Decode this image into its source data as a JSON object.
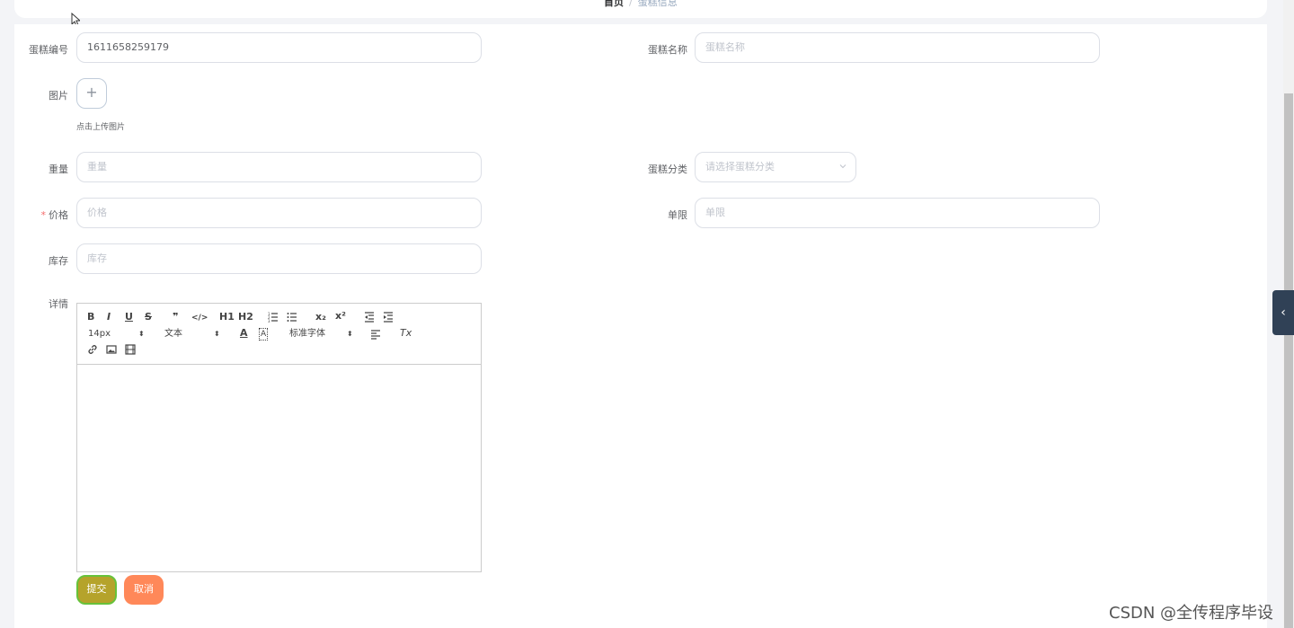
{
  "breadcrumb": {
    "home": "首页",
    "separator": "/",
    "current": "蛋糕信息"
  },
  "form": {
    "cake_no": {
      "label": "蛋糕编号",
      "value": "1611658259179"
    },
    "cake_name": {
      "label": "蛋糕名称",
      "placeholder": "蛋糕名称"
    },
    "image": {
      "label": "图片",
      "upload_icon": "+",
      "tip": "点击上传图片"
    },
    "weight": {
      "label": "重量",
      "placeholder": "重量"
    },
    "category": {
      "label": "蛋糕分类",
      "placeholder": "请选择蛋糕分类"
    },
    "price": {
      "label": "价格",
      "required_mark": "*",
      "placeholder": "价格"
    },
    "limit": {
      "label": "单限",
      "placeholder": "单限"
    },
    "stock": {
      "label": "库存",
      "placeholder": "库存"
    },
    "details": {
      "label": "详情"
    }
  },
  "editor": {
    "toolbar_row1": [
      "B",
      "I",
      "U",
      "S",
      "❞",
      "</>",
      "H1",
      "H2",
      "ol",
      "ul",
      "x₂",
      "x²",
      "outdent",
      "indent"
    ],
    "font_size": "14px",
    "header": "文本",
    "font_family": "标准字体",
    "picker_arrow": "⬍",
    "color_icon": "A",
    "bg_icon": "A",
    "clean_icon": "Tx"
  },
  "buttons": {
    "submit": "提交",
    "cancel": "取消"
  },
  "side_toggle_icon": "‹",
  "watermark": "CSDN @全传程序毕设",
  "colors": {
    "submit": "#b5a32b",
    "cancel": "#ff8859",
    "sidebar": "#304156"
  }
}
